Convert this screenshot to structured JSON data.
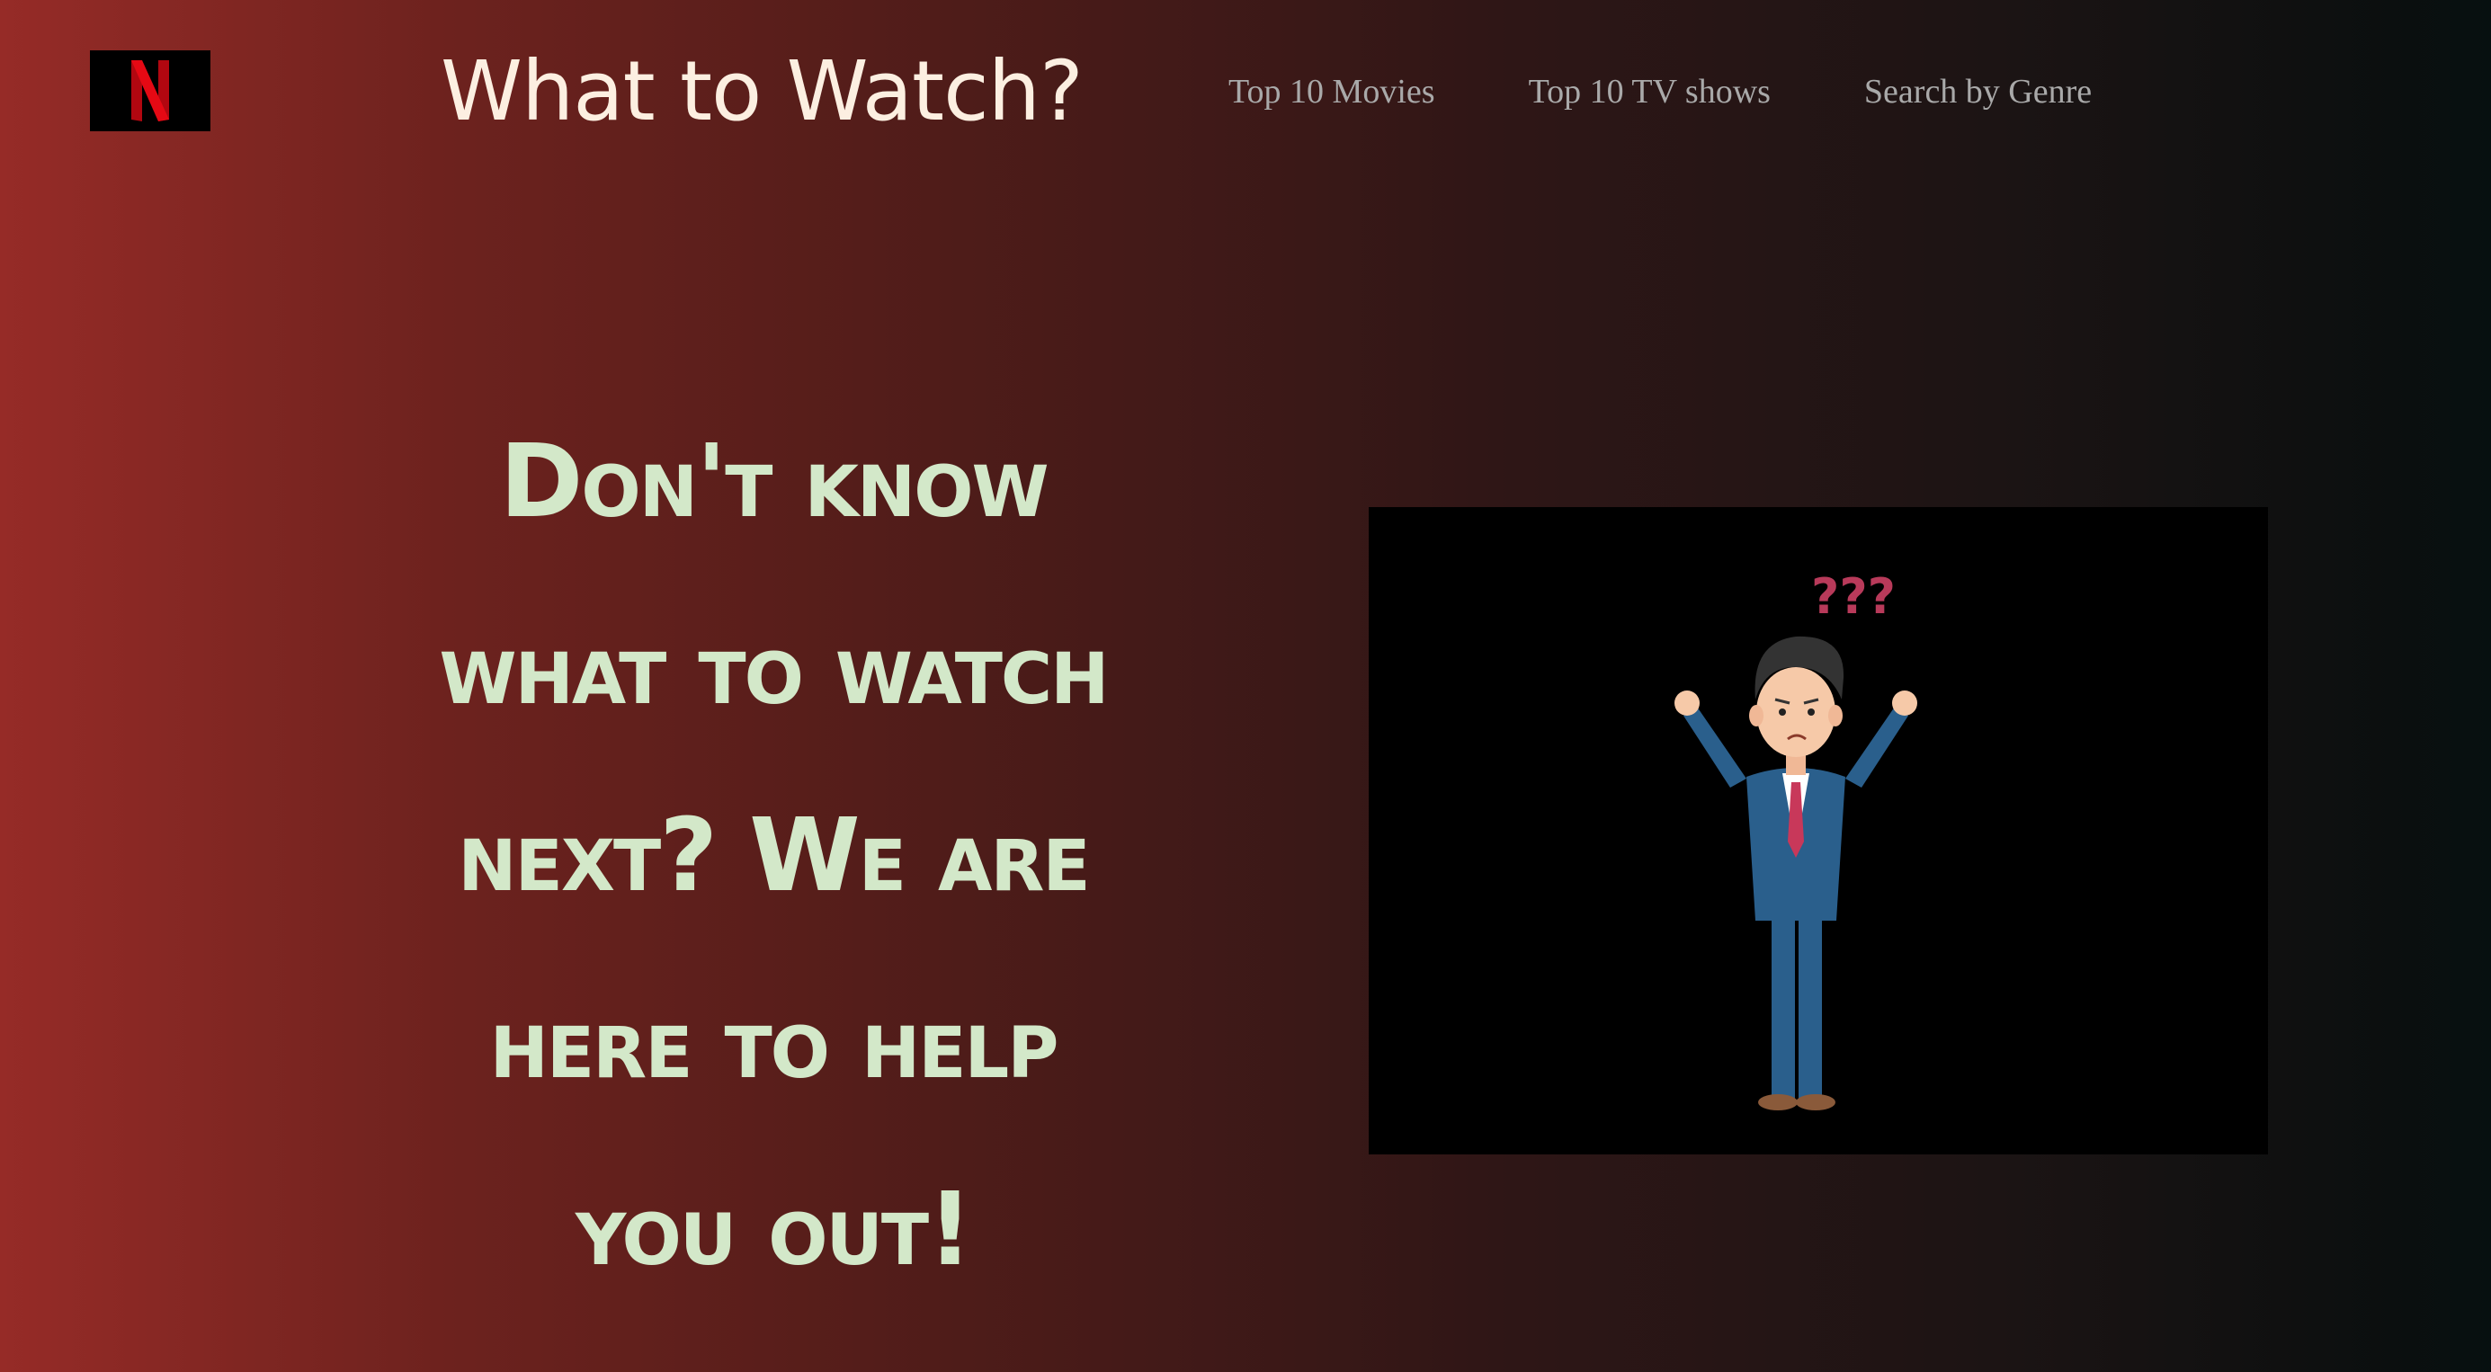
{
  "header": {
    "logo_letter": "N",
    "title": "What to Watch?",
    "nav": [
      {
        "label": "Top 10 Movies"
      },
      {
        "label": "Top 10 TV shows"
      },
      {
        "label": "Search by Genre"
      }
    ]
  },
  "hero": {
    "lines": [
      "Don't know",
      "what to watch",
      "next? We are",
      "here to help",
      "you out!"
    ],
    "illustration_glyph": "???"
  },
  "colors": {
    "accent_red": "#e50914",
    "hero_text": "#d3e8c9",
    "title_text": "#fcefe1",
    "nav_text": "#a9a9a9"
  }
}
